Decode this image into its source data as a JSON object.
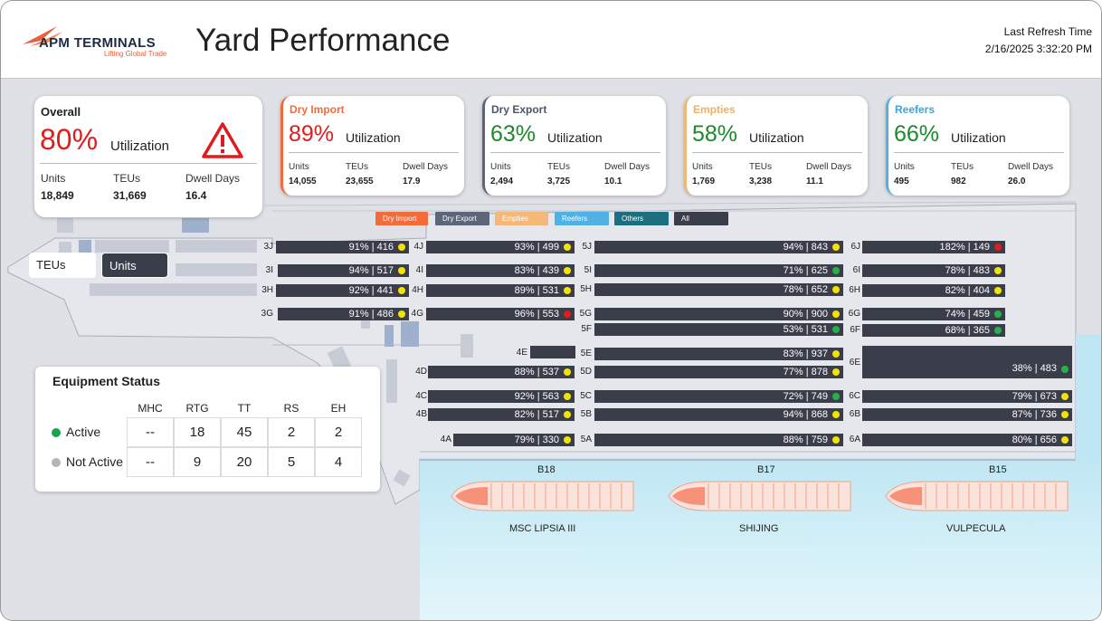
{
  "header": {
    "logo_name": "APM TERMINALS",
    "logo_tagline": "Lifting Global Trade",
    "title": "Yard Performance",
    "refresh_label": "Last Refresh Time",
    "refresh_value": "2/16/2025 3:32:20 PM"
  },
  "cards": {
    "overall": {
      "title": "Overall",
      "percent": "80%",
      "util_label": "Utilization",
      "units_label": "Units",
      "teus_label": "TEUs",
      "dwell_label": "Dwell Days",
      "units": "18,849",
      "teus": "31,669",
      "dwell": "16.4",
      "color": "#e11b1b",
      "icon": "warning-triangle-icon"
    },
    "dry_import": {
      "title": "Dry Import",
      "percent": "89%",
      "util_label": "Utilization",
      "units_label": "Units",
      "teus_label": "TEUs",
      "dwell_label": "Dwell Days",
      "units": "14,055",
      "teus": "23,655",
      "dwell": "17.9",
      "title_color": "#f26b3a",
      "percent_color": "#e11b1b",
      "border_color": "#f26b3a"
    },
    "dry_export": {
      "title": "Dry Export",
      "percent": "63%",
      "util_label": "Utilization",
      "units_label": "Units",
      "teus_label": "TEUs",
      "dwell_label": "Dwell Days",
      "units": "2,494",
      "teus": "3,725",
      "dwell": "10.1",
      "title_color": "#4a5668",
      "percent_color": "#1a8a2a",
      "border_color": "#5b6679"
    },
    "empties": {
      "title": "Empties",
      "percent": "58%",
      "util_label": "Utilization",
      "units_label": "Units",
      "teus_label": "TEUs",
      "dwell_label": "Dwell Days",
      "units": "1,769",
      "teus": "3,238",
      "dwell": "11.1",
      "title_color": "#f0b060",
      "percent_color": "#1a8a2a",
      "border_color": "#f0b878"
    },
    "reefers": {
      "title": "Reefers",
      "percent": "66%",
      "util_label": "Utilization",
      "units_label": "Units",
      "teus_label": "TEUs",
      "dwell_label": "Dwell Days",
      "units": "495",
      "teus": "982",
      "dwell": "26.0",
      "title_color": "#3aa6dd",
      "percent_color": "#1a8a2a",
      "border_color": "#4fb2e3"
    }
  },
  "filters": [
    {
      "label": "Dry Import",
      "color": "#f26b3a"
    },
    {
      "label": "Dry Export",
      "color": "#5b6679"
    },
    {
      "label": "Empties",
      "color": "#f5b878"
    },
    {
      "label": "Reefers",
      "color": "#4fb2e3"
    },
    {
      "label": "Others",
      "color": "#1d6e7e"
    },
    {
      "label": "All",
      "color": "#3a3d4a"
    }
  ],
  "toggle": {
    "teus_label": "TEUs",
    "units_label": "Units",
    "selected": "Units"
  },
  "yard_rows": [
    {
      "row": "3J",
      "text": "91% | 416",
      "status": "yellow"
    },
    {
      "row": "4J",
      "text": "93% | 499",
      "status": "yellow"
    },
    {
      "row": "5J",
      "text": "94% | 843",
      "status": "yellow"
    },
    {
      "row": "6J",
      "text": "182% | 149",
      "status": "red"
    },
    {
      "row": "3I",
      "text": "94% | 517",
      "status": "yellow"
    },
    {
      "row": "4I",
      "text": "83% | 439",
      "status": "yellow"
    },
    {
      "row": "5I",
      "text": "71% | 625",
      "status": "green"
    },
    {
      "row": "6I",
      "text": "78% | 483",
      "status": "yellow"
    },
    {
      "row": "3H",
      "text": "92% | 441",
      "status": "yellow"
    },
    {
      "row": "4H",
      "text": "89% | 531",
      "status": "yellow"
    },
    {
      "row": "5H",
      "text": "78% | 652",
      "status": "yellow"
    },
    {
      "row": "6H",
      "text": "82% | 404",
      "status": "yellow"
    },
    {
      "row": "3G",
      "text": "91% | 486",
      "status": "yellow"
    },
    {
      "row": "4G",
      "text": "96% | 553",
      "status": "red"
    },
    {
      "row": "5G",
      "text": "90% | 900",
      "status": "yellow"
    },
    {
      "row": "6G",
      "text": "74% | 459",
      "status": "green"
    },
    {
      "row": "5F",
      "text": "53% | 531",
      "status": "green"
    },
    {
      "row": "6F",
      "text": "68% | 365",
      "status": "green"
    },
    {
      "row": "4E",
      "text": "",
      "status": "none"
    },
    {
      "row": "5E",
      "text": "83% | 937",
      "status": "yellow"
    },
    {
      "row": "6E",
      "text": "38% | 483",
      "status": "green"
    },
    {
      "row": "4D",
      "text": "88% | 537",
      "status": "yellow"
    },
    {
      "row": "5D",
      "text": "77% | 878",
      "status": "yellow"
    },
    {
      "row": "4C",
      "text": "92% | 563",
      "status": "yellow"
    },
    {
      "row": "5C",
      "text": "72% | 749",
      "status": "green"
    },
    {
      "row": "6C",
      "text": "79% | 673",
      "status": "yellow"
    },
    {
      "row": "4B",
      "text": "82% | 517",
      "status": "yellow"
    },
    {
      "row": "5B",
      "text": "94% | 868",
      "status": "yellow"
    },
    {
      "row": "6B",
      "text": "87% | 736",
      "status": "yellow"
    },
    {
      "row": "4A",
      "text": "79% | 330",
      "status": "yellow"
    },
    {
      "row": "5A",
      "text": "88% | 759",
      "status": "yellow"
    },
    {
      "row": "6A",
      "text": "80% | 656",
      "status": "yellow"
    }
  ],
  "berths": [
    {
      "berth": "B18",
      "vessel": "MSC LIPSIA III"
    },
    {
      "berth": "B17",
      "vessel": "SHIJING"
    },
    {
      "berth": "B15",
      "vessel": "VULPECULA"
    }
  ],
  "equipment": {
    "title": "Equipment Status",
    "columns": [
      "MHC",
      "RTG",
      "TT",
      "RS",
      "EH"
    ],
    "rows": [
      {
        "label": "Active",
        "dot_color": "#1aa34a",
        "values": [
          "--",
          "18",
          "45",
          "2",
          "2"
        ]
      },
      {
        "label": "Not Active",
        "dot_color": "#b5b5b5",
        "values": [
          "--",
          "9",
          "20",
          "5",
          "4"
        ]
      }
    ]
  }
}
